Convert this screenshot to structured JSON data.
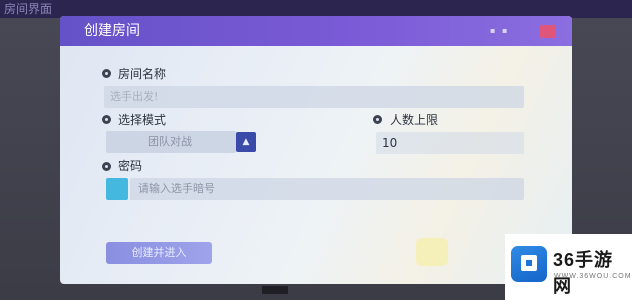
{
  "background": {
    "title": "房间界面"
  },
  "dialog": {
    "title": "创建房间",
    "header_hint": "▪ ▪",
    "room_name": {
      "label": "房间名称",
      "value": "选手出发!"
    },
    "mode": {
      "label": "选择模式",
      "selected": "团队对战",
      "toggle_glyph": "▲"
    },
    "max_players": {
      "label": "人数上限",
      "value": "10"
    },
    "password": {
      "label": "密码",
      "placeholder": "请输入选手暗号"
    },
    "confirm_label": "创建并进入"
  },
  "watermark": {
    "brand": "36手游网",
    "url": "WWW.36WOU.COM"
  },
  "colors": {
    "header": "#7a5ad6",
    "close": "#e0567a",
    "select_button": "#3a4aa8",
    "password_icon": "#45b8e0",
    "confirm": "#8a8fe0"
  }
}
